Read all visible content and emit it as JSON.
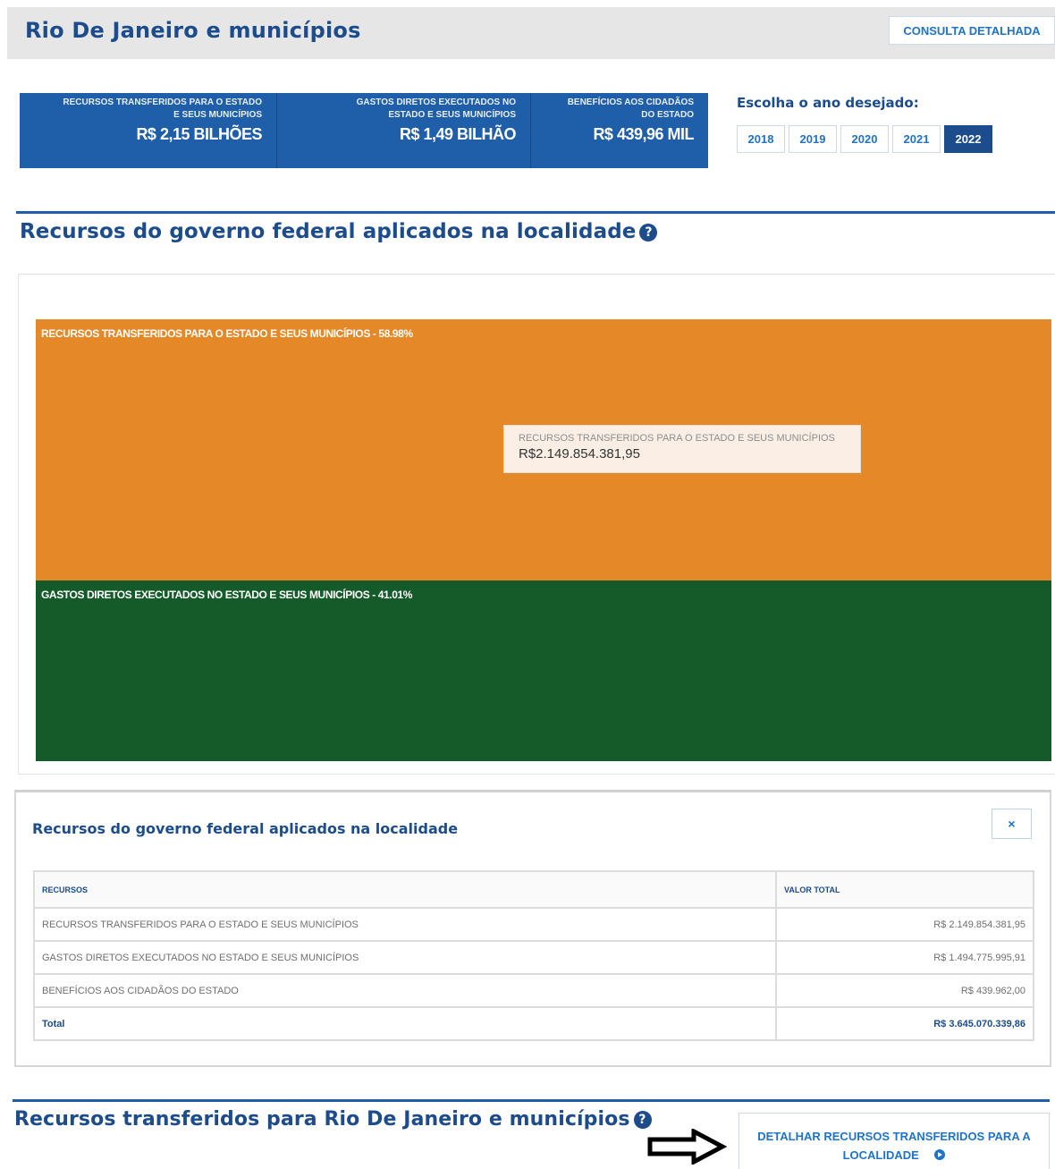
{
  "header": {
    "breadcrumb": "",
    "title": "Rio De Janeiro e municípios",
    "consult_button": "CONSULTA DETALHADA"
  },
  "summary": [
    {
      "label_line1": "RECURSOS TRANSFERIDOS PARA O ESTADO",
      "label_line2": "E SEUS MUNICÍPIOS",
      "value": "R$ 2,15 BILHÕES"
    },
    {
      "label_line1": "GASTOS DIRETOS EXECUTADOS NO",
      "label_line2": "ESTADO E SEUS MUNICÍPIOS",
      "value": "R$ 1,49 BILHÃO"
    },
    {
      "label_line1": "BENEFÍCIOS AOS CIDADÃOS",
      "label_line2": "DO ESTADO",
      "value": "R$ 439,96 MIL"
    }
  ],
  "year_selector": {
    "label": "Escolha o ano desejado:",
    "years": [
      "2018",
      "2019",
      "2020",
      "2021",
      "2022"
    ],
    "selected": "2022"
  },
  "section1": {
    "title": "Recursos do governo federal aplicados na localidade"
  },
  "treemap": {
    "blocks": [
      {
        "label": "RECURSOS TRANSFERIDOS PARA O ESTADO E SEUS MUNICÍPIOS - 58.98%",
        "color": "#e58828"
      },
      {
        "label": "GASTOS DIRETOS EXECUTADOS NO ESTADO E SEUS MUNICÍPIOS - 41.01%",
        "color": "#155a29"
      }
    ],
    "tooltip": {
      "title": "RECURSOS TRANSFERIDOS PARA O ESTADO E SEUS MUNICÍPIOS",
      "value": "R$2.149.854.381,95"
    }
  },
  "panel": {
    "title": "Recursos do governo federal aplicados na localidade",
    "close_label": "×",
    "columns": [
      "RECURSOS",
      "VALOR TOTAL"
    ],
    "rows": [
      {
        "name": "RECURSOS TRANSFERIDOS PARA O ESTADO E SEUS MUNICÍPIOS",
        "value": "R$ 2.149.854.381,95"
      },
      {
        "name": "GASTOS DIRETOS EXECUTADOS NO ESTADO E SEUS MUNICÍPIOS",
        "value": "R$ 1.494.775.995,91"
      },
      {
        "name": "BENEFÍCIOS AOS CIDADÃOS DO ESTADO",
        "value": "R$ 439.962,00"
      }
    ],
    "total": {
      "name": "Total",
      "value": "R$ 3.645.070.339,86"
    }
  },
  "section2": {
    "title": "Recursos transferidos para Rio De Janeiro e municípios",
    "detail_button_line1": "DETALHAR RECURSOS TRANSFERIDOS PARA A",
    "detail_button_line2": "LOCALIDADE"
  },
  "colors": {
    "brand_blue": "#1c4c8c",
    "summary_blue": "#1f5ea8",
    "orange": "#e58828",
    "green": "#155a29"
  }
}
